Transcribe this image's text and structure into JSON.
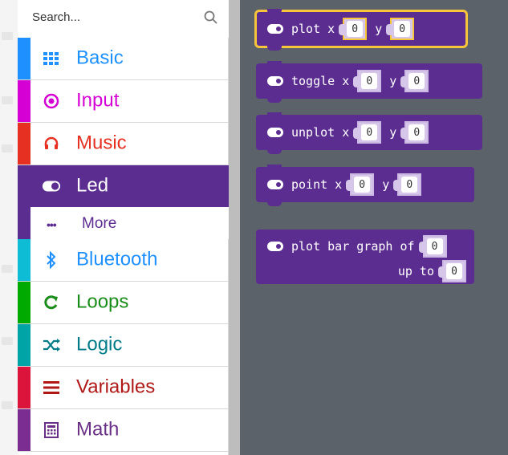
{
  "search": {
    "placeholder": "Search..."
  },
  "categories": [
    {
      "label": "Basic",
      "color": "#1e90ff",
      "icon": "grid-icon"
    },
    {
      "label": "Input",
      "color": "#d400d4",
      "icon": "radio-button-icon"
    },
    {
      "label": "Music",
      "color": "#e63022",
      "icon": "headphones-icon"
    },
    {
      "label": "Led",
      "color": "#5c2d91",
      "icon": "toggle-icon"
    },
    {
      "label": "More",
      "color": "#5c2d91",
      "icon": "ellipsis-icon"
    },
    {
      "label": "Bluetooth",
      "color": "#0fbcd6",
      "icon": "bluetooth-icon"
    },
    {
      "label": "Loops",
      "color": "#00aa00",
      "icon": "loop-icon"
    },
    {
      "label": "Logic",
      "color": "#00a4a6",
      "icon": "shuffle-icon"
    },
    {
      "label": "Variables",
      "color": "#dc143c",
      "icon": "list-icon"
    },
    {
      "label": "Math",
      "color": "#9400d3",
      "icon": "calculator-icon"
    }
  ],
  "blocks": {
    "plot": {
      "kw": "plot x",
      "y": "y",
      "x_val": "0",
      "y_val": "0"
    },
    "toggle": {
      "kw": "toggle x",
      "y": "y",
      "x_val": "0",
      "y_val": "0"
    },
    "unplot": {
      "kw": "unplot x",
      "y": "y",
      "x_val": "0",
      "y_val": "0"
    },
    "point": {
      "kw": "point x",
      "y": "y",
      "x_val": "0",
      "y_val": "0"
    },
    "plotbar": {
      "kw": "plot bar graph of",
      "upto": "up to",
      "val": "0",
      "upto_val": "0"
    }
  },
  "colors": {
    "accent": "#5c2d91",
    "flyout_bg": "#5b626a",
    "highlight": "#f8c53a"
  }
}
